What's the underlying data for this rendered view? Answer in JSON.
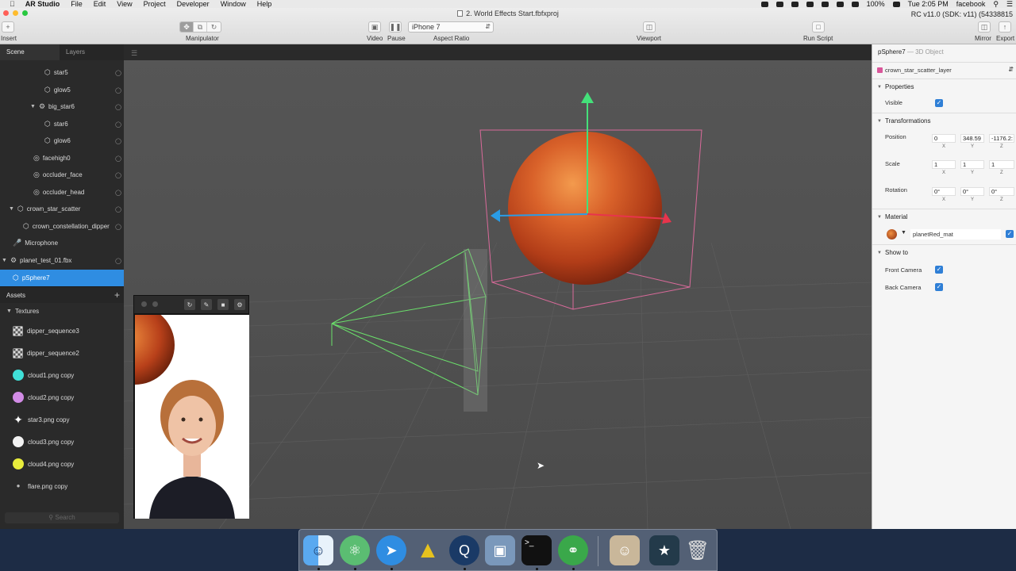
{
  "menubar": {
    "apple": "",
    "app_name": "AR Studio",
    "items": [
      "File",
      "Edit",
      "View",
      "Project",
      "Developer",
      "Window",
      "Help"
    ],
    "battery": "100%",
    "clock": "Tue 2:05 PM",
    "user": "facebook"
  },
  "titlebar": {
    "document": "2. World Effects Start.fbfxproj",
    "sdk_info": "RC v11.0 (SDK: v11) (54338815",
    "insert_label": "Insert",
    "manipulator_label": "Manipulator",
    "video_label": "Video",
    "pause_label": "Pause",
    "device": "iPhone 7",
    "aspect_label": "Aspect Ratio",
    "viewport_label": "Viewport",
    "run_script_label": "Run Script",
    "mirror_label": "Mirror",
    "export_label": "Export"
  },
  "left_panel": {
    "tabs": [
      "Scene",
      "Layers"
    ],
    "scene_items": [
      {
        "label": "star5",
        "icon": "object-icon"
      },
      {
        "label": "glow5",
        "icon": "object-icon"
      },
      {
        "label": "big_star6",
        "icon": "null-object-icon"
      },
      {
        "label": "star6",
        "icon": "object-icon"
      },
      {
        "label": "glow6",
        "icon": "object-icon"
      },
      {
        "label": "facehigh0",
        "icon": "face-mesh-icon"
      },
      {
        "label": "occluder_face",
        "icon": "face-mesh-icon"
      },
      {
        "label": "occluder_head",
        "icon": "face-mesh-icon"
      },
      {
        "label": "crown_star_scatter",
        "icon": "object-icon"
      },
      {
        "label": "crown_constellation_dipper",
        "icon": "object-icon"
      },
      {
        "label": "Microphone",
        "icon": "microphone-icon"
      },
      {
        "label": "planet_test_01.fbx",
        "icon": "null-object-icon"
      },
      {
        "label": "pSphere7",
        "icon": "object-icon"
      }
    ],
    "assets_label": "Assets",
    "textures_label": "Textures",
    "assets": [
      {
        "label": "dipper_sequence3",
        "icon": "sequence-icon"
      },
      {
        "label": "dipper_sequence2",
        "icon": "sequence-icon"
      },
      {
        "label": "cloud1.png copy",
        "color": "#40e0d8"
      },
      {
        "label": "cloud2.png copy",
        "color": "#d28ce6"
      },
      {
        "label": "star3.png copy",
        "color": "#ffffff"
      },
      {
        "label": "cloud3.png copy",
        "color": "#f2f2f2"
      },
      {
        "label": "cloud4.png copy",
        "color": "#e8ec3c"
      },
      {
        "label": "flare.png copy",
        "color": "#bbbbbb"
      }
    ],
    "search_placeholder": "Search"
  },
  "inspector": {
    "object_name": "pSphere7",
    "object_type": "— 3D Object",
    "layer": "crown_star_scatter_layer",
    "layer_color": "#d9569a",
    "properties_label": "Properties",
    "visible_label": "Visible",
    "transformations_label": "Transformations",
    "position_label": "Position",
    "position": [
      "0",
      "348.59",
      "-1176.2:"
    ],
    "scale_label": "Scale",
    "scale": [
      "1",
      "1",
      "1"
    ],
    "rotation_label": "Rotation",
    "rotation": [
      "0°",
      "0°",
      "0°"
    ],
    "axes": [
      "X",
      "Y",
      "Z"
    ],
    "material_label": "Material",
    "material_name": "planetRed_mat",
    "show_to_label": "Show to",
    "front_camera_label": "Front Camera",
    "back_camera_label": "Back Camera"
  },
  "colors": {
    "accent": "#2f8de2",
    "planet": "#c2451c",
    "gizmo_x": "#e8344c",
    "gizmo_y": "#44e07a",
    "gizmo_z": "#2a9ce6",
    "bbox": "#d96a9a",
    "camera_frustum": "#6be06b"
  },
  "dock_apps": [
    "finder-icon",
    "atom-icon",
    "safari-icon",
    "aquarium-icon",
    "quicktime-icon",
    "preview-icon",
    "terminal-icon",
    "network-icon",
    "photo-icon",
    "image-icon",
    "trash-icon"
  ]
}
